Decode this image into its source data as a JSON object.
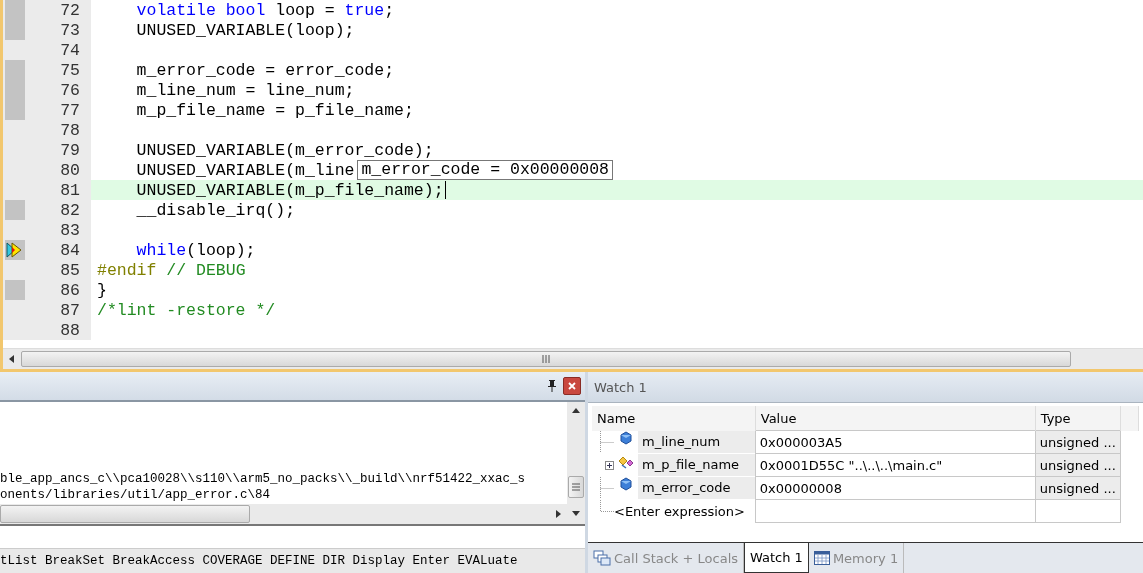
{
  "editor": {
    "lines": [
      {
        "number": "72",
        "coverage": true,
        "tokens": [
          {
            "text": "    volatile bool",
            "kind": "keyword"
          },
          {
            "text": " loop = ",
            "kind": "plain"
          },
          {
            "text": "true",
            "kind": "keyword"
          },
          {
            "text": ";",
            "kind": "plain"
          }
        ]
      },
      {
        "number": "73",
        "coverage": true,
        "tokens": [
          {
            "text": "    UNUSED_VARIABLE(loop);",
            "kind": "plain"
          }
        ]
      },
      {
        "number": "74",
        "coverage": false
      },
      {
        "number": "75",
        "coverage": true,
        "tokens": [
          {
            "text": "    m_error_code = error_code;",
            "kind": "plain"
          }
        ]
      },
      {
        "number": "76",
        "coverage": true,
        "tokens": [
          {
            "text": "    m_line_num = line_num;",
            "kind": "plain"
          }
        ]
      },
      {
        "number": "77",
        "coverage": true,
        "tokens": [
          {
            "text": "    m_p_file_name = p_file_name;",
            "kind": "plain"
          }
        ]
      },
      {
        "number": "78",
        "coverage": false
      },
      {
        "number": "79",
        "coverage": false,
        "tokens": [
          {
            "text": "    UNUSED_VARIABLE(m_error_code);",
            "kind": "plain"
          }
        ]
      },
      {
        "number": "80",
        "coverage": false,
        "tokens": [
          {
            "text": "    UNUSED_VARIABLE(m_line",
            "kind": "plain"
          }
        ],
        "tooltip": "m_error_code = 0x00000008"
      },
      {
        "number": "81",
        "coverage": false,
        "highlighted": true,
        "tokens": [
          {
            "text": "    UNUSED_VARIABLE(m_p_file_name);",
            "kind": "plain"
          }
        ]
      },
      {
        "number": "82",
        "coverage": true,
        "tokens": [
          {
            "text": "    __disable_irq();",
            "kind": "plain"
          }
        ]
      },
      {
        "number": "83",
        "coverage": false
      },
      {
        "number": "84",
        "coverage": true,
        "current": true,
        "tokens": [
          {
            "text": "    while",
            "kind": "keyword"
          },
          {
            "text": "(loop);",
            "kind": "plain"
          }
        ]
      },
      {
        "number": "85",
        "coverage": false,
        "tokens": [
          {
            "text": "#endif",
            "kind": "preprocessor"
          },
          {
            "text": " // DEBUG",
            "kind": "comment"
          }
        ]
      },
      {
        "number": "86",
        "coverage": true,
        "tokens": [
          {
            "text": "}",
            "kind": "plain"
          }
        ]
      },
      {
        "number": "87",
        "coverage": false,
        "tokens": [
          {
            "text": "/*lint -restore */",
            "kind": "comment"
          }
        ]
      },
      {
        "number": "88",
        "coverage": false
      }
    ]
  },
  "output": {
    "lines": [
      "ble_app_ancs_c\\\\pca10028\\\\s110\\\\arm5_no_packs\\\\_build\\\\nrf51422_xxac_s",
      "onents/libraries/util/app_error.c\\84"
    ],
    "command_hint": "tList BreakSet BreakAccess COVERAGE DEFINE DIR Display Enter EVALuate"
  },
  "watch": {
    "title": "Watch 1",
    "columns": [
      "Name",
      "Value",
      "Type"
    ],
    "rows": [
      {
        "kind": "variable",
        "expandable": false,
        "name": "m_line_num",
        "value": "0x000003A5",
        "type": "unsigned ..."
      },
      {
        "kind": "pointer",
        "expandable": true,
        "name": "m_p_file_name",
        "value": "0x0001D55C \"..\\..\\..\\main.c\"",
        "type": "unsigned ..."
      },
      {
        "kind": "variable",
        "expandable": false,
        "name": "m_error_code",
        "value": "0x00000008",
        "type": "unsigned ..."
      }
    ],
    "enter_row": "<Enter expression>",
    "tabs": [
      {
        "label": "Call Stack + Locals",
        "kind": "callstack",
        "selected": false
      },
      {
        "label": "Watch 1",
        "kind": "watch",
        "selected": true
      },
      {
        "label": "Memory 1",
        "kind": "memory",
        "selected": false
      }
    ]
  }
}
